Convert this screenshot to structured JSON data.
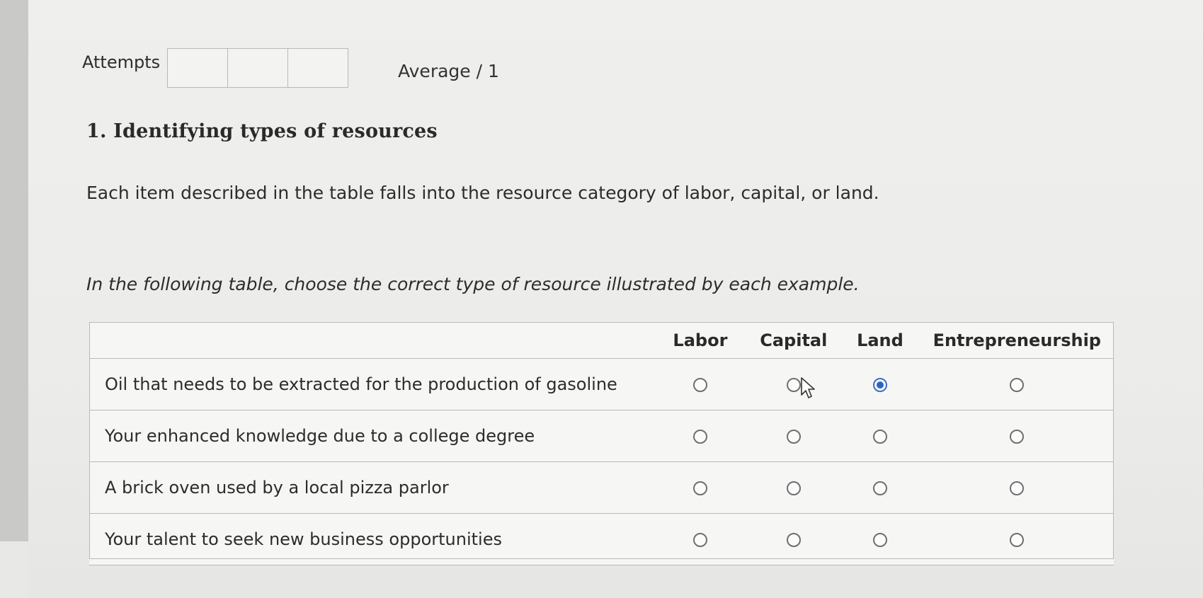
{
  "attempts": {
    "label": "Attempts",
    "boxes": [
      "",
      "",
      ""
    ]
  },
  "average": {
    "label": "Average / 1"
  },
  "question": {
    "title": "1. Identifying types of resources",
    "intro": "Each item described in the table falls into the resource category of labor, capital, or land.",
    "instruction": "In the following table, choose the correct type of resource illustrated by each example."
  },
  "table": {
    "columns": [
      "Labor",
      "Capital",
      "Land",
      "Entrepreneurship"
    ],
    "rows": [
      {
        "item": "Oil that needs to be extracted for the production of gasoline",
        "selected": "Land"
      },
      {
        "item": "Your enhanced knowledge due to a college degree",
        "selected": ""
      },
      {
        "item": "A brick oven used by a local pizza parlor",
        "selected": ""
      },
      {
        "item": "Your talent to seek new business opportunities",
        "selected": ""
      }
    ]
  },
  "colors": {
    "selected_radio": "#2f63c0",
    "radio_border": "#6f6f6f",
    "table_border": "#b9b9b9"
  },
  "icons": {
    "cursor": "mouse-pointer-icon"
  }
}
